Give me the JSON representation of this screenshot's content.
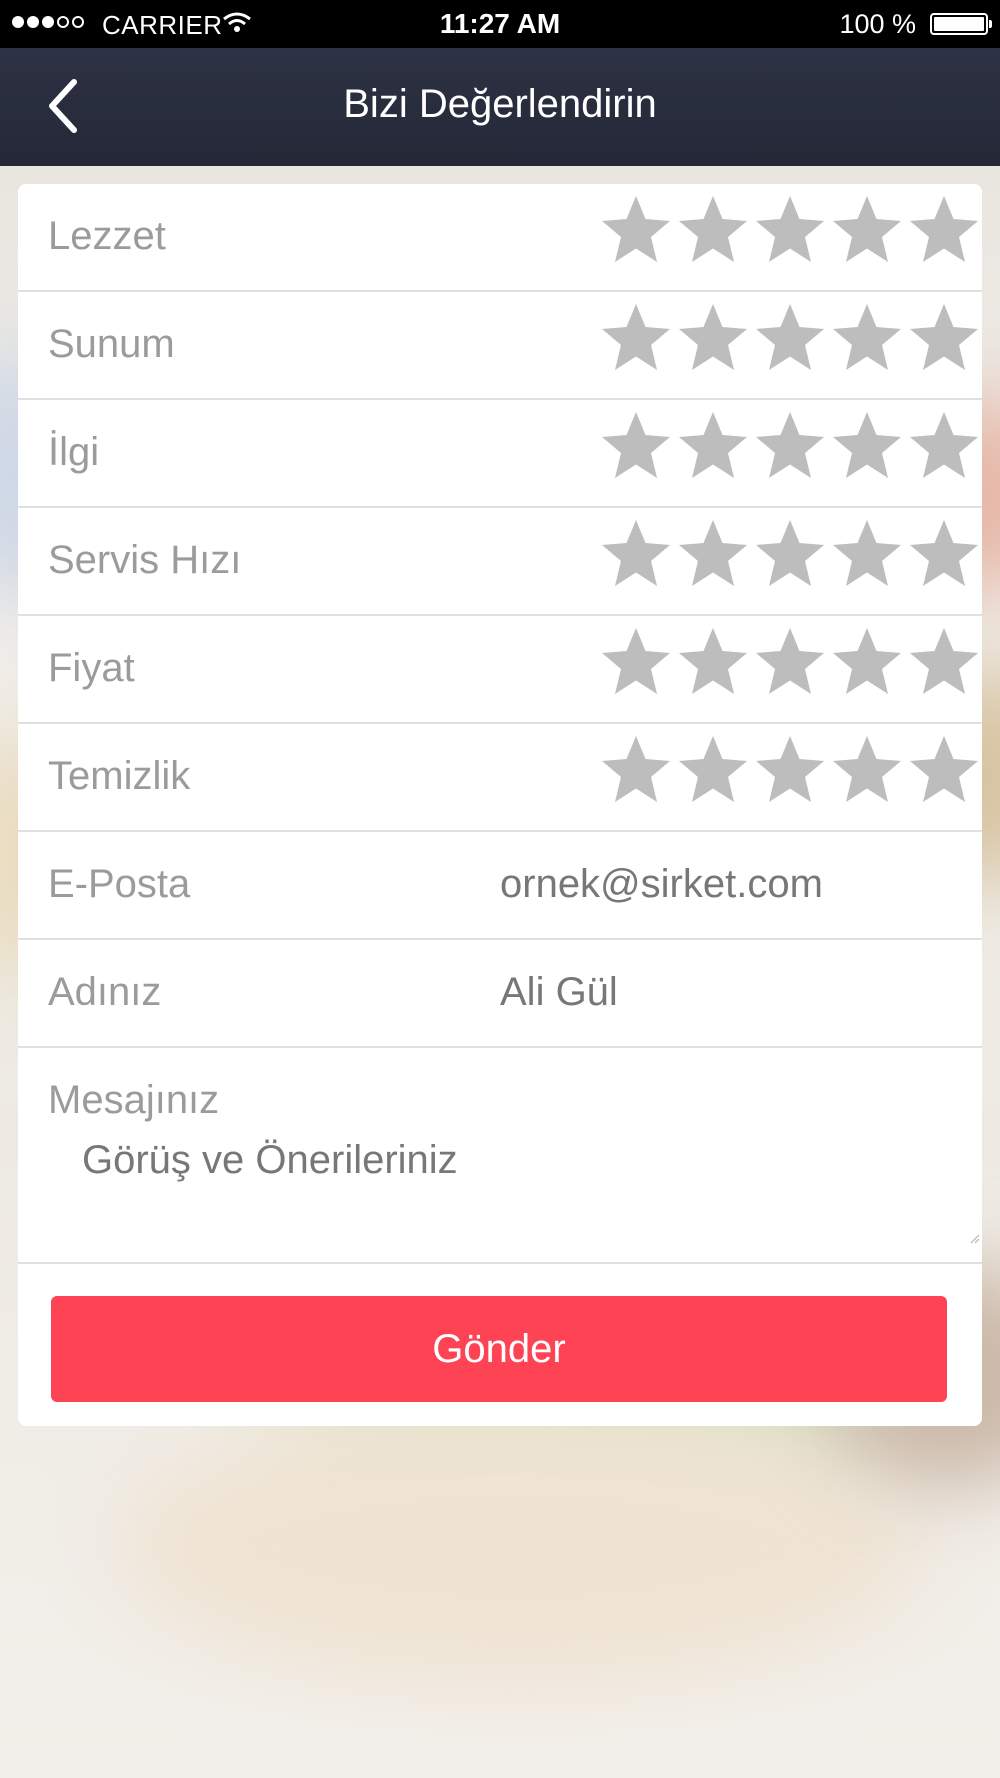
{
  "status_bar": {
    "carrier": "CARRIER",
    "time": "11:27 AM",
    "battery": "100 %"
  },
  "nav": {
    "title": "Bizi Değerlendirin",
    "back_icon": "chevron-left-icon"
  },
  "ratings": [
    {
      "label": "Lezzet",
      "stars": 0,
      "max": 5
    },
    {
      "label": "Sunum",
      "stars": 0,
      "max": 5
    },
    {
      "label": "İlgi",
      "stars": 0,
      "max": 5
    },
    {
      "label": "Servis Hızı",
      "stars": 0,
      "max": 5
    },
    {
      "label": "Fiyat",
      "stars": 0,
      "max": 5
    },
    {
      "label": "Temizlik",
      "stars": 0,
      "max": 5
    }
  ],
  "form": {
    "email": {
      "label": "E-Posta",
      "placeholder": "ornek@sirket.com"
    },
    "name": {
      "label": "Adınız",
      "placeholder": "Ali Gül"
    },
    "message": {
      "label": "Mesajınız",
      "placeholder": "Görüş ve Önerileriniz"
    }
  },
  "submit_label": "Gönder",
  "colors": {
    "nav_bg": "#282c3c",
    "button_bg": "#fd4354",
    "star_empty": "#bdbdbd",
    "label_text": "#9b9b9b"
  }
}
